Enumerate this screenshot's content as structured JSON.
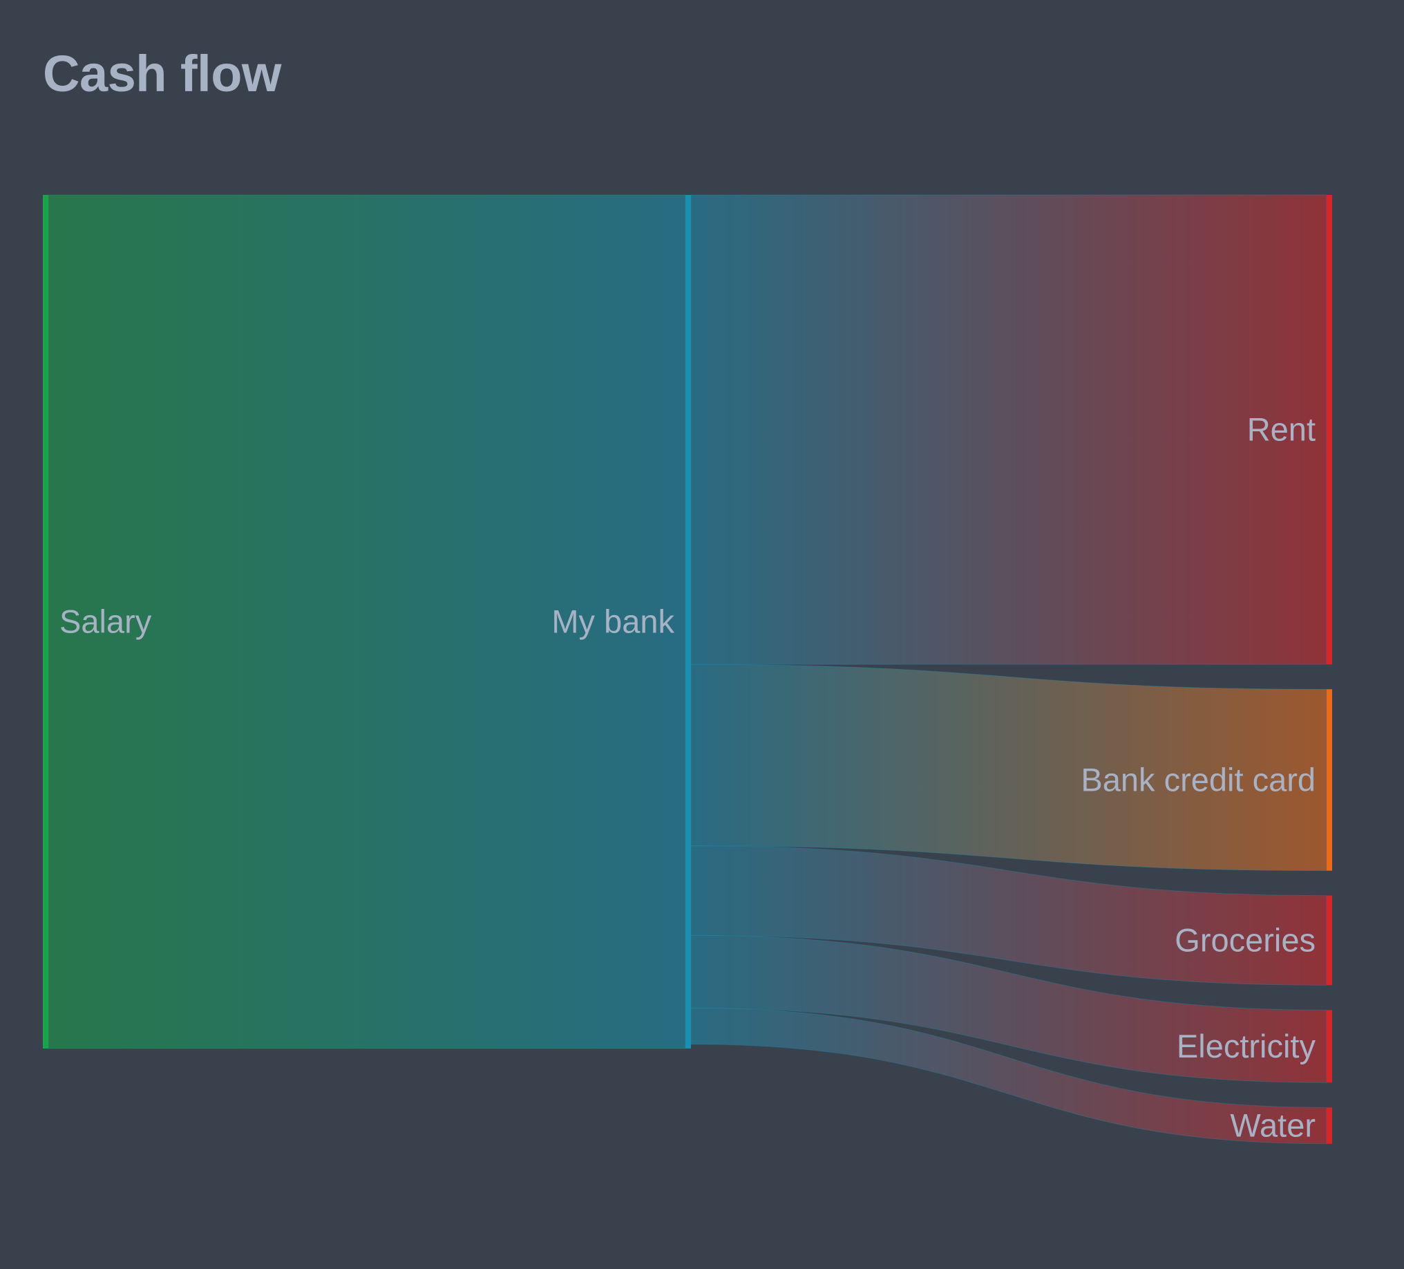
{
  "colors": {
    "background": "#39414c",
    "text": "#a7b3c5",
    "green": "#1aa34a",
    "teal": "#1b8fb0",
    "red": "#d62728",
    "orange": "#ee6b16"
  },
  "chart_data": {
    "type": "sankey",
    "title": "Cash flow",
    "nodes": [
      {
        "id": "salary",
        "name": "Salary",
        "column": 0,
        "color": "#1aa34a"
      },
      {
        "id": "bank",
        "name": "My bank",
        "column": 1,
        "color": "#1b8fb0"
      },
      {
        "id": "rent",
        "name": "Rent",
        "column": 2,
        "color": "#d62728"
      },
      {
        "id": "card",
        "name": "Bank credit card",
        "column": 2,
        "color": "#ee6b16"
      },
      {
        "id": "groceries",
        "name": "Groceries",
        "column": 2,
        "color": "#d62728"
      },
      {
        "id": "electricity",
        "name": "Electricity",
        "column": 2,
        "color": "#d62728"
      },
      {
        "id": "water",
        "name": "Water",
        "column": 2,
        "color": "#d62728"
      }
    ],
    "links": [
      {
        "source": "salary",
        "target": "bank",
        "value": 4000
      },
      {
        "source": "bank",
        "target": "rent",
        "value": 2200
      },
      {
        "source": "bank",
        "target": "card",
        "value": 850
      },
      {
        "source": "bank",
        "target": "groceries",
        "value": 420
      },
      {
        "source": "bank",
        "target": "electricity",
        "value": 340
      },
      {
        "source": "bank",
        "target": "water",
        "value": 170
      }
    ]
  }
}
